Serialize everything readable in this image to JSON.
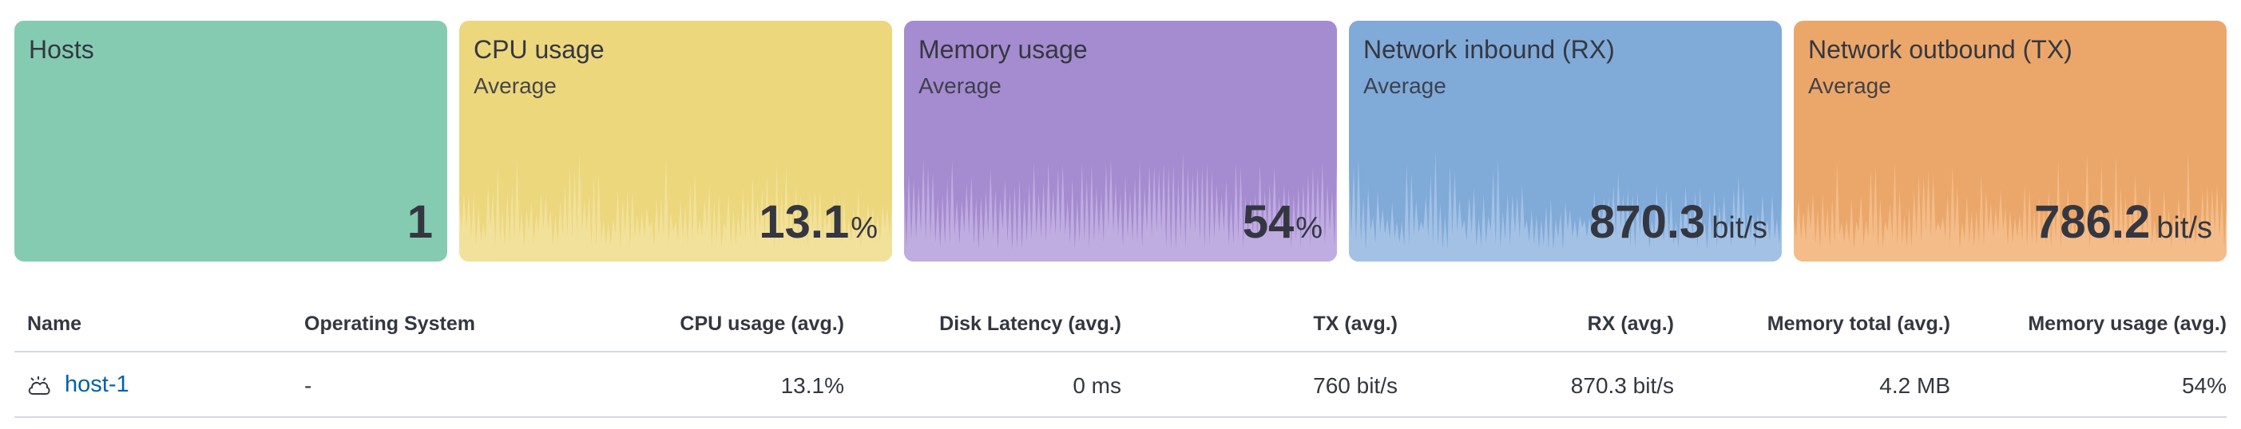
{
  "cards": [
    {
      "title": "Hosts",
      "subtitle": "",
      "value": "1",
      "unit": "",
      "color": "#85cbb1",
      "spark_color": "#85cbb1"
    },
    {
      "title": "CPU usage",
      "subtitle": "Average",
      "value": "13.1",
      "unit": "%",
      "color": "#ecd77d",
      "spark_color": "#f3e3a0"
    },
    {
      "title": "Memory usage",
      "subtitle": "Average",
      "value": "54",
      "unit": "%",
      "color": "#a58bcf",
      "spark_color": "#c3b1e3"
    },
    {
      "title": "Network inbound (RX)",
      "subtitle": "Average",
      "value": "870.3",
      "unit": "bit/s",
      "color": "#80aad8",
      "spark_color": "#a9c6e8"
    },
    {
      "title": "Network outbound (TX)",
      "subtitle": "Average",
      "value": "786.2",
      "unit": "bit/s",
      "color": "#eba76a",
      "spark_color": "#f4c08e"
    }
  ],
  "table": {
    "headers": [
      "Name",
      "Operating System",
      "CPU usage (avg.)",
      "Disk Latency (avg.)",
      "TX (avg.)",
      "RX (avg.)",
      "Memory total (avg.)",
      "Memory usage (avg.)"
    ],
    "rows": [
      {
        "name": "host-1",
        "os": "-",
        "cpu": "13.1%",
        "disk_latency": "0 ms",
        "tx": "760 bit/s",
        "rx": "870.3 bit/s",
        "mem_total": "4.2 MB",
        "mem_usage": "54%"
      }
    ]
  }
}
